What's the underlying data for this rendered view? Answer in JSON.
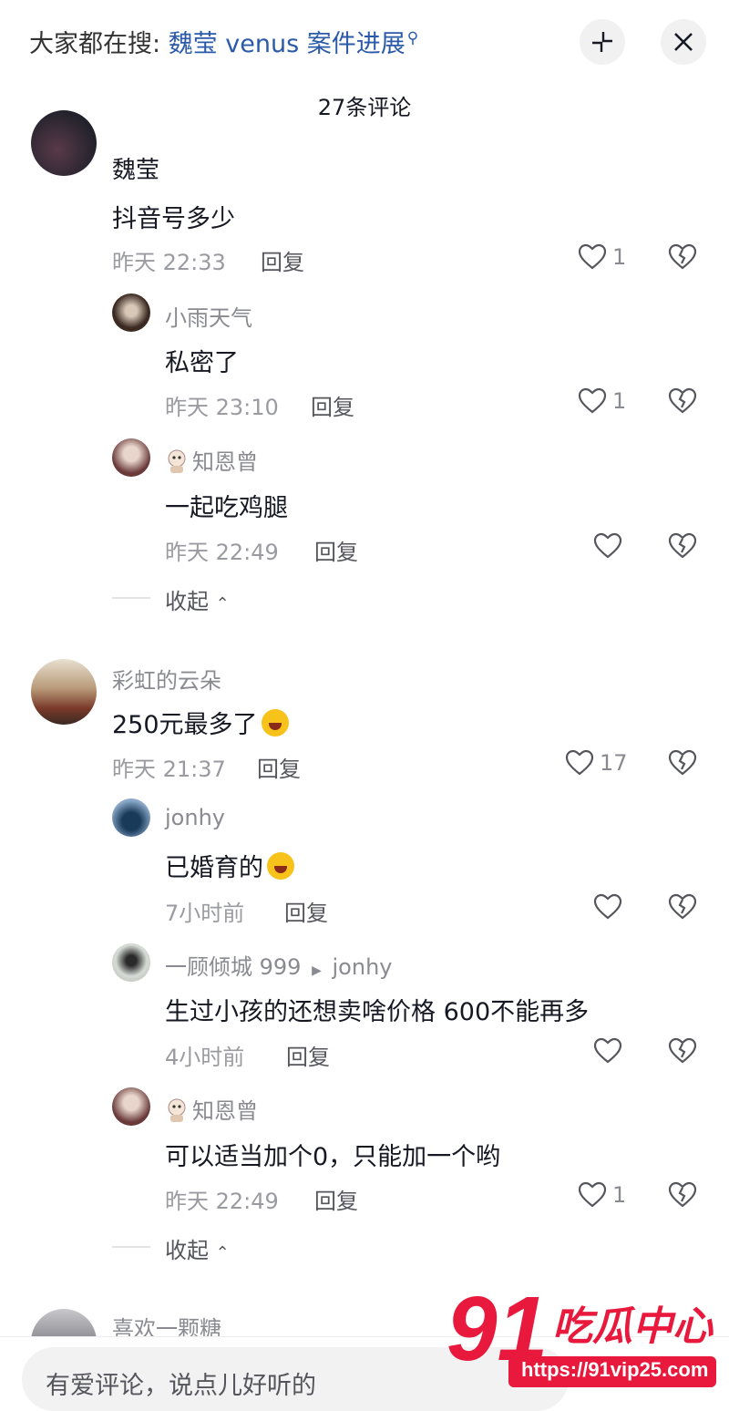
{
  "header": {
    "search_prefix": "大家都在搜:",
    "search_keyword": "魏莹 venus 案件进展",
    "search_icon": "search-icon",
    "collapse_icon": "minimize-icon",
    "close_icon": "close-icon",
    "comment_count": "27条评论"
  },
  "comments": [
    {
      "name": "魏莹",
      "text": "抖音号多少",
      "time": "昨天 22:33",
      "reply_label": "回复",
      "likes": "1",
      "replies": [
        {
          "name": "小雨天气",
          "text": "私密了",
          "time": "昨天 23:10",
          "reply_label": "回复",
          "likes": "1"
        },
        {
          "name": "知恩曾",
          "text": "一起吃鸡腿",
          "time": "昨天 22:49",
          "reply_label": "回复",
          "likes": ""
        }
      ],
      "collapse_label": "收起"
    },
    {
      "name": "彩虹的云朵",
      "text": "250元最多了",
      "time": "昨天 21:37",
      "reply_label": "回复",
      "likes": "17",
      "replies": [
        {
          "name": "jonhy",
          "text": "已婚育的",
          "time": "7小时前",
          "reply_label": "回复",
          "likes": ""
        },
        {
          "name": "一顾倾城 999",
          "reply_to": "jonhy",
          "text": "生过小孩的还想卖啥价格 600不能再多",
          "time": "4小时前",
          "reply_label": "回复",
          "likes": ""
        },
        {
          "name": "知恩曾",
          "text": "可以适当加个0，只能加一个哟",
          "time": "昨天 22:49",
          "reply_label": "回复",
          "likes": "1"
        }
      ],
      "collapse_label": "收起"
    },
    {
      "name": "喜欢一颗糖"
    }
  ],
  "input": {
    "placeholder": "有爱评论，说点儿好听的"
  },
  "watermark": {
    "brand": "91吃瓜中心",
    "url": "https://91vip25.com"
  },
  "colors": {
    "link": "#2b5aa8",
    "watermark_red": "#e8193c"
  }
}
